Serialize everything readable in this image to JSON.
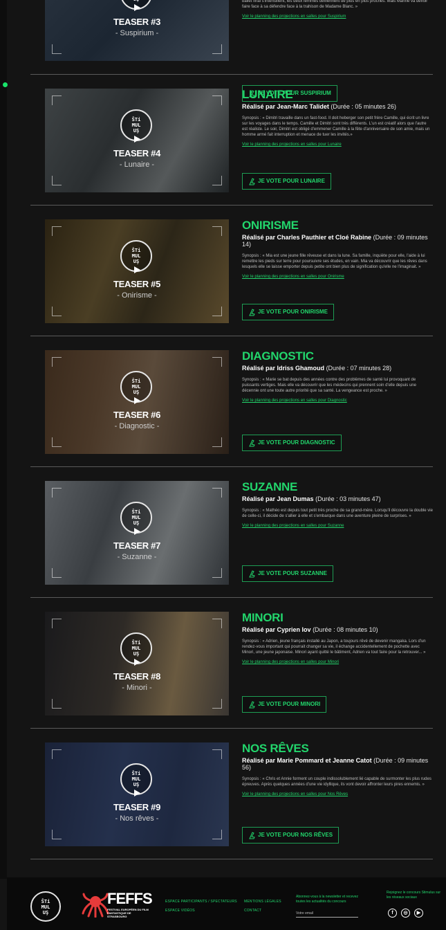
{
  "brand": {
    "logo_lines": [
      "ŜTi",
      "MUL",
      "UŞ"
    ]
  },
  "top_partial": {
    "teaser_label": "TEASER #3",
    "teaser_sub": "- Suspirium -",
    "synopsis_tail": "ballet final s'intensifient, les deux femmes deviennent de plus en plus proches. Mais Marine va devoir faire face à sa défendre face à la trahison de Madame Blanc. »",
    "planning": "Voir le planning des projections en salles pour Suspirium",
    "vote": "JE VOTE POUR SUSPIRIUM"
  },
  "entries": [
    {
      "teaser_label": "TEASER #4",
      "teaser_sub": "- Lunaire -",
      "title": "LUNAIRE",
      "director_prefix": "Réalisé par Jean-Marc Talidet",
      "duration": "(Durée : 05 minutes 26)",
      "synopsis": "Synopsis : « Dimitri travaille dans un fast-food. Il doit heberger son petit frère Camille, qui écrit un livre sur les voyages dans le temps. Camille et Dimitri sont très différents. L'un est créatif alors que l'autre est réaliste. Le soir, Dimitri est obligé d'emmener Camille à la fête d'anniversaire de son amie, mais un homme armé fait interruption et menace de tuer les invités.»",
      "planning": "Voir le planning des projections en salles pour Lunaire",
      "vote": "JE VOTE POUR LUNAIRE"
    },
    {
      "teaser_label": "TEASER #5",
      "teaser_sub": "- Onirisme -",
      "title": "ONIRISME",
      "director_prefix": "Réalisé par Charles Pauthier et Cloé Rabine",
      "duration": "(Durée : 09 minutes 14)",
      "synopsis": "Synopsis : « Mia est une jeune fille rêveuse et dans la lune. Sa famille, inquiète pour elle, l'aide à lui remettre les pieds sur terre pour poursuivre ses études, en vain. Mia va découvrir que les rêves dans lesquels elle se laisse emporter depuis petite ont bien plus de signification qu'elle ne l'imaginait. »",
      "planning": "Voir le planning des projections en salles pour Onirisme",
      "vote": "JE VOTE POUR ONIRISME"
    },
    {
      "teaser_label": "TEASER #6",
      "teaser_sub": "- Diagnostic -",
      "title": "DIAGNOSTIC",
      "director_prefix": "Réalisé par Idriss Ghamoud",
      "duration": "(Durée : 07 minutes 28)",
      "synopsis": "Synopsis : « Marie se bat depuis des années contre des problèmes de santé lui provoquant de puissants vertiges. Mais elle va découvrir que les médecins qui prennent soin d'elle depuis une décennie ont une toute autre priorité que sa santé. La vengeance est proche. »",
      "planning": "Voir le planning des projections en salles pour Diagnostic",
      "vote": "JE VOTE POUR DIAGNOSTIC"
    },
    {
      "teaser_label": "TEASER #7",
      "teaser_sub": "- Suzanne -",
      "title": "SUZANNE",
      "director_prefix": "Réalisé par Jean Dumas",
      "duration": "(Durée : 03 minutes 47)",
      "synopsis": "Synopsis : « Mathéo est depuis tout petit très proche de sa grand-mère. Lorsqu'il découvre la double vie de celle-ci, il décide de s'allier à elle et s'embarque dans une aventure pleine de surprises. »",
      "planning": "Voir le planning des projections en salles pour Suzanne",
      "vote": "JE VOTE POUR SUZANNE"
    },
    {
      "teaser_label": "TEASER #8",
      "teaser_sub": "- Minori -",
      "title": "MINORI",
      "director_prefix": "Réalisé par Cyprien Iov",
      "duration": "(Durée : 08 minutes 10)",
      "synopsis": "Synopsis : « Adrien, jeune français installé au Japon, a toujours rêvé de devenir mangaka. Lors d'un rendez-vous important qui pourrait changer sa vie, il échange accidentellement de pochette avec Minori, une jeune japonaise. Minori ayant quitté le bâtiment, Adrien va tout faire pour la retrouver... »",
      "planning": "Voir le planning des projections en salles pour Minori",
      "vote": "JE VOTE POUR MINORI"
    },
    {
      "teaser_label": "TEASER #9",
      "teaser_sub": "- Nos rêves -",
      "title": "NOS RÊVES",
      "director_prefix": "Réalisé par Marie Pommard et Jeanne Catot",
      "duration": "(Durée : 09 minutes 56)",
      "synopsis": "Synopsis : « Chris et Annie forment un couple indissolublement lié capable de surmonter les plus rudes épreuves. Après quelques années d'une vie idyllique, ils vont devoir affronter leurs pires ennemis. »",
      "planning": "Voir le planning des projections en salles pour Nos Rêves",
      "vote": "JE VOTE POUR NOS RÊVES"
    }
  ],
  "footer": {
    "feffs_name": "FEFFS",
    "feffs_sub": "FESTIVAL EUROPÉEN DU FILM FANTASTIQUE DE STRASBOURG",
    "link_participants": "ESPACE PARTICIPANTS / SPECTATEURS",
    "link_videos": "ESPACE VIDÉOS",
    "link_legal": "MENTIONS LÉGALES",
    "link_contact": "CONTACT",
    "newsletter_text": "Abonnez-vous à la newsletter et recevez toutes les actualités du concours",
    "newsletter_placeholder": "Votre email",
    "social_text": "Rejoignez le concours Stimulus sur les réseaux sociaux",
    "social": [
      "f",
      "◎",
      "▶"
    ]
  },
  "colors": {
    "accent": "#22d66c",
    "background": "#141414"
  }
}
